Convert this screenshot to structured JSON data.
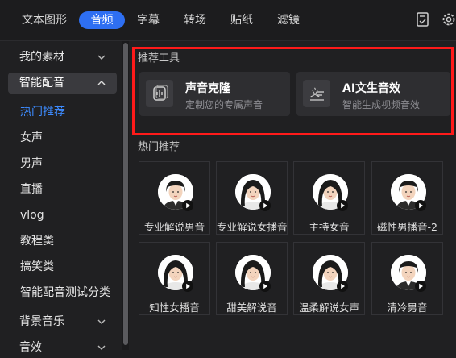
{
  "tabs": [
    {
      "label": "文本图形",
      "active": false
    },
    {
      "label": "音频",
      "active": true
    },
    {
      "label": "字幕",
      "active": false
    },
    {
      "label": "转场",
      "active": false
    },
    {
      "label": "贴纸",
      "active": false
    },
    {
      "label": "滤镜",
      "active": false
    }
  ],
  "top_icons": [
    "document-check-icon",
    "gear-icon"
  ],
  "sidebar": {
    "groups": [
      {
        "label": "我的素材",
        "expanded": false
      },
      {
        "label": "智能配音",
        "expanded": true
      },
      {
        "label": "背景音乐",
        "expanded": false
      },
      {
        "label": "音效",
        "expanded": false
      }
    ],
    "items": [
      "热门推荐",
      "女声",
      "男声",
      "直播",
      "vlog",
      "教程类",
      "搞笑类",
      "智能配音测试分类"
    ],
    "active_item": "热门推荐"
  },
  "recommend": {
    "title": "推荐工具",
    "tools": [
      {
        "title": "声音克隆",
        "subtitle": "定制您的专属声音",
        "icon": "voice-clone-icon"
      },
      {
        "title": "AI文生音效",
        "subtitle": "智能生成视频音效",
        "icon": "text-to-sound-icon"
      }
    ]
  },
  "hot": {
    "title": "热门推荐",
    "voices": [
      {
        "label": "专业解说男音",
        "gender": "male"
      },
      {
        "label": "专业解说女播音",
        "gender": "female"
      },
      {
        "label": "主持女音",
        "gender": "female"
      },
      {
        "label": "磁性男播音-2",
        "gender": "male"
      },
      {
        "label": "知性女播音",
        "gender": "female"
      },
      {
        "label": "甜美解说音",
        "gender": "female"
      },
      {
        "label": "温柔解说女声",
        "gender": "female"
      },
      {
        "label": "清冷男音",
        "gender": "male"
      }
    ]
  },
  "colors": {
    "accent": "#2e6ff2",
    "active_text": "#3d8bff",
    "highlight_border": "#ff1a1a"
  }
}
